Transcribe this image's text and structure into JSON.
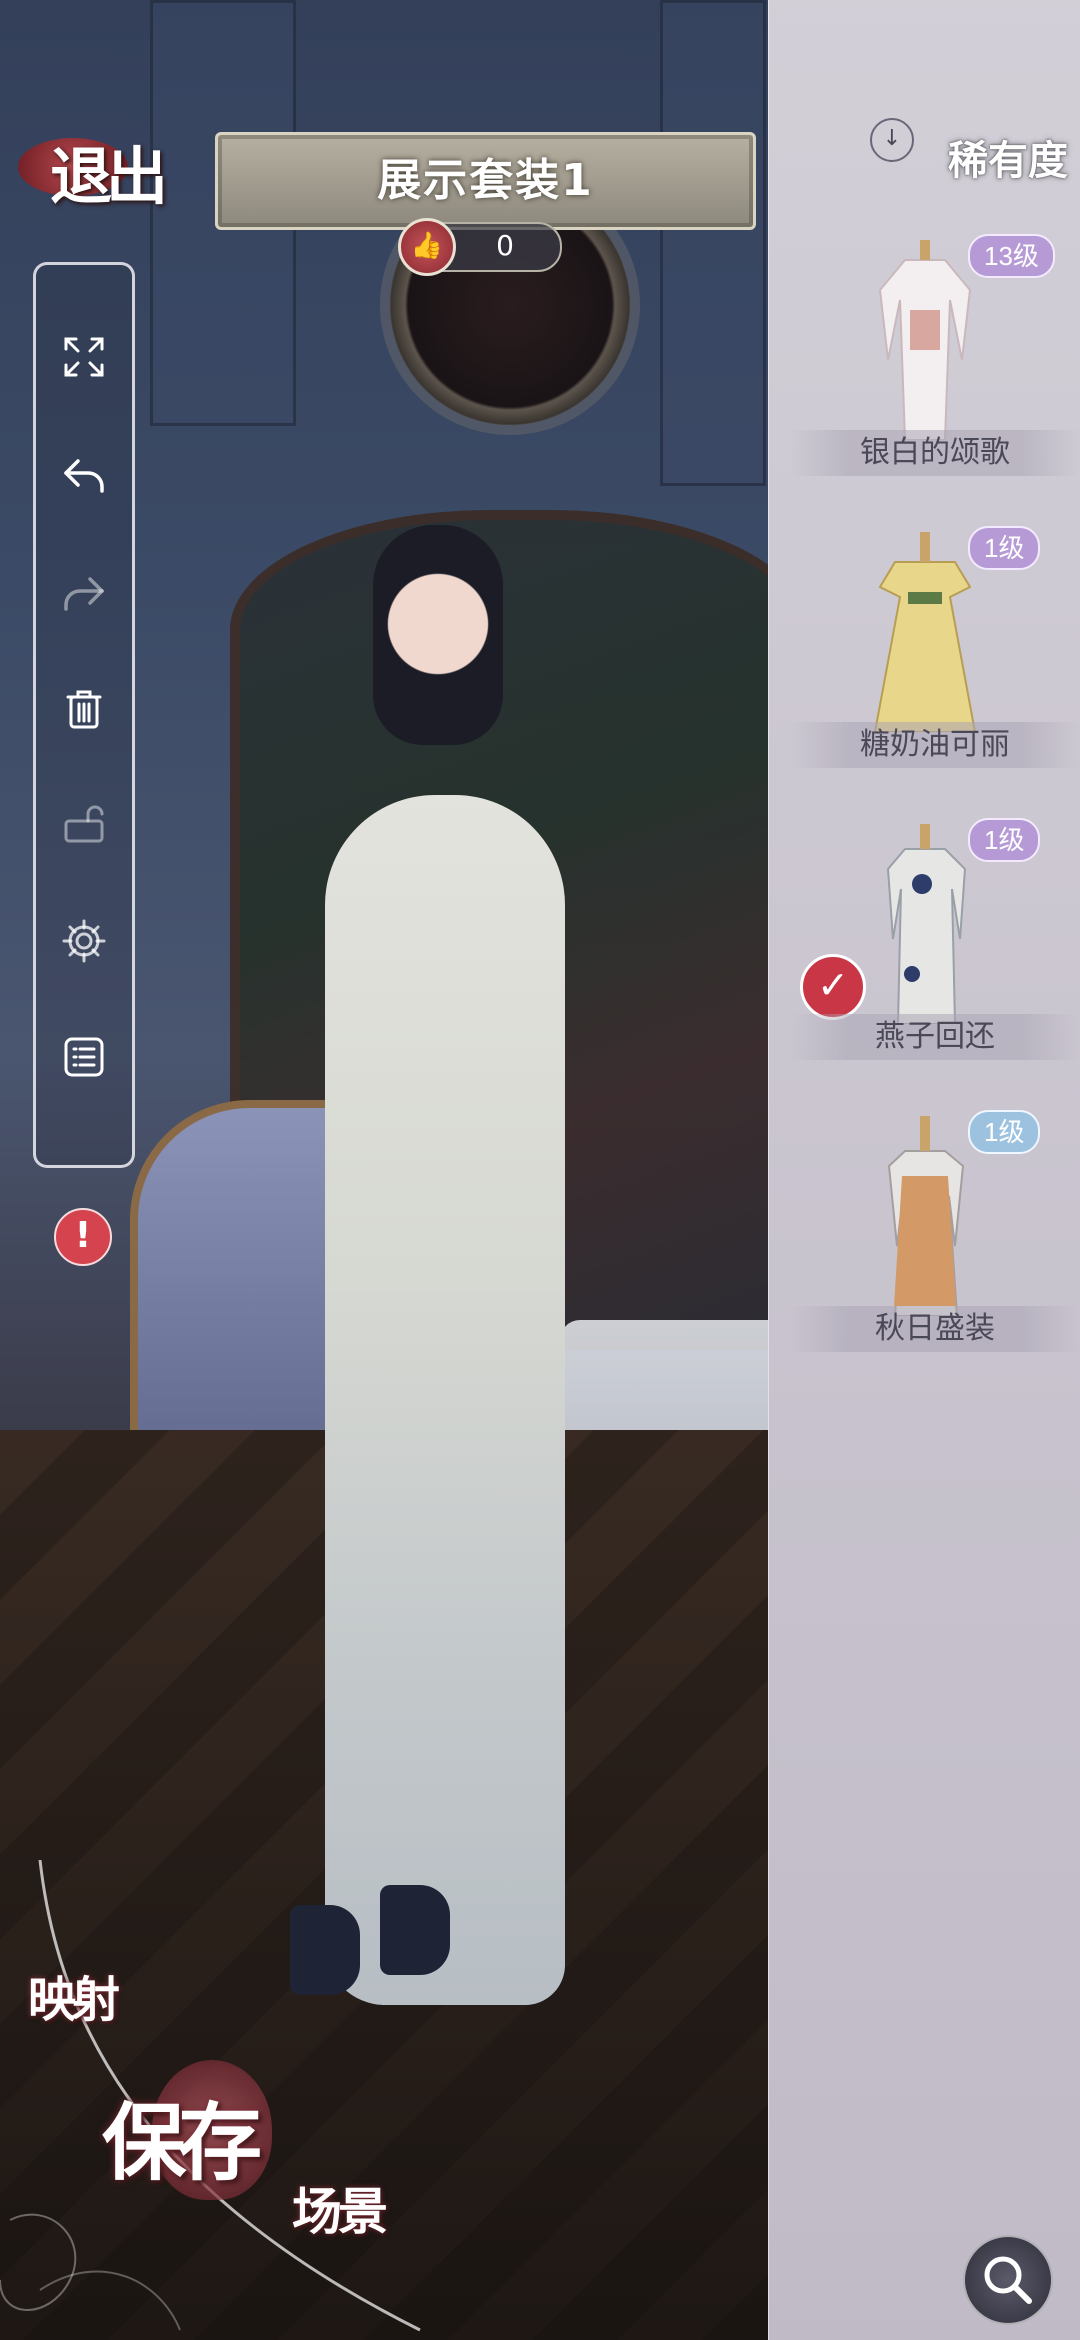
{
  "header": {
    "exit_label": "退出",
    "outfit_title": "展示套装1",
    "like_count": "0"
  },
  "toolbar": {
    "icons": [
      "fullscreen-icon",
      "undo-icon",
      "redo-icon",
      "trash-icon",
      "lock-icon",
      "gear-icon",
      "list-icon"
    ]
  },
  "alert": {
    "glyph": "!"
  },
  "right_panel": {
    "sort_label": "稀有度",
    "items": [
      {
        "name": "银白的颂歌",
        "level": "13级",
        "badge_color": "#b69ad6",
        "selected": false
      },
      {
        "name": "糖奶油可丽",
        "level": "1级",
        "badge_color": "#b69ad6",
        "selected": false
      },
      {
        "name": "燕子回还",
        "level": "1级",
        "badge_color": "#b69ad6",
        "selected": true
      },
      {
        "name": "秋日盛装",
        "level": "1级",
        "badge_color": "#9cc2df",
        "selected": false
      }
    ]
  },
  "bottom": {
    "map_label": "映射",
    "save_label": "保存",
    "scene_label": "场景"
  },
  "colors": {
    "accent_red": "#c93645",
    "panel_bg": "#dcd6e0",
    "banner": "#a39d90"
  }
}
